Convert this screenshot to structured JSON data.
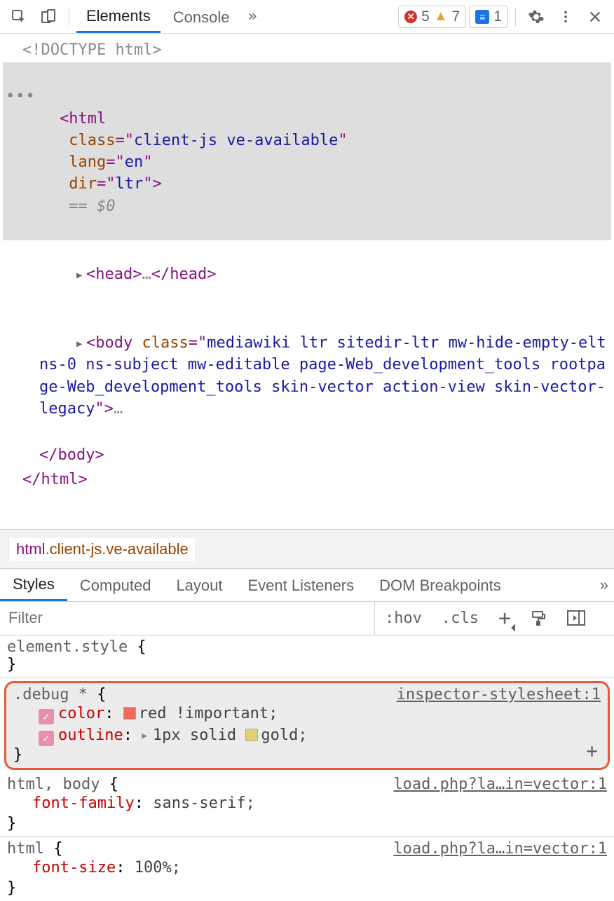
{
  "toolbar": {
    "tabs": [
      {
        "label": "Elements",
        "active": true
      },
      {
        "label": "Console",
        "active": false
      }
    ],
    "error_count": "5",
    "warn_count": "7",
    "issue_count": "1"
  },
  "dom": {
    "doctype": "<!DOCTYPE html>",
    "html_open": {
      "tag": "html",
      "attrs": [
        {
          "name": "class",
          "value": "client-js ve-available"
        },
        {
          "name": "lang",
          "value": "en"
        },
        {
          "name": "dir",
          "value": "ltr"
        }
      ],
      "suffix": "== $0"
    },
    "head": {
      "open": "<head>",
      "mid": "…",
      "close": "</head>"
    },
    "body_open": {
      "tag": "body",
      "class_value": "mediawiki ltr sitedir-ltr mw-hide-empty-elt ns-0 ns-subject mw-editable page-Web_development_tools rootpage-Web_development_tools skin-vector action-view skin-vector-legacy",
      "trailing": "…"
    },
    "body_close": "</body>",
    "html_close": "</html>"
  },
  "breadcrumb": {
    "tag": "html",
    "classes": ".client-js.ve-available"
  },
  "tabs2": [
    {
      "label": "Styles",
      "active": true
    },
    {
      "label": "Computed",
      "active": false
    },
    {
      "label": "Layout",
      "active": false
    },
    {
      "label": "Event Listeners",
      "active": false
    },
    {
      "label": "DOM Breakpoints",
      "active": false
    }
  ],
  "filter": {
    "placeholder": "Filter",
    "hov": ":hov",
    "cls": ".cls"
  },
  "rules": [
    {
      "selector": "element.style",
      "brace_open": " {",
      "brace_close": "}",
      "source": null,
      "props": [],
      "highlight": false,
      "show_add": false
    },
    {
      "selector": ".debug *",
      "brace_open": " {",
      "brace_close": "}",
      "source": "inspector-stylesheet:1",
      "highlight": true,
      "show_add": true,
      "props": [
        {
          "check": true,
          "name": "color",
          "sw": "#ef6b5a",
          "value": "red !important;"
        },
        {
          "check": true,
          "name": "outline",
          "tri": true,
          "sw": "#e4cf73",
          "value": "1px solid  gold;"
        }
      ]
    },
    {
      "selector": "html, body",
      "brace_open": " {",
      "brace_close": "}",
      "source": "load.php?la…in=vector:1",
      "highlight": false,
      "show_add": false,
      "props": [
        {
          "name": "font-family",
          "value": "sans-serif;"
        }
      ]
    },
    {
      "selector": "html",
      "brace_open": " {",
      "brace_close": "}",
      "source": "load.php?la…in=vector:1",
      "highlight": false,
      "show_add": false,
      "props": [
        {
          "name": "font-size",
          "value": "100%;"
        }
      ]
    }
  ]
}
